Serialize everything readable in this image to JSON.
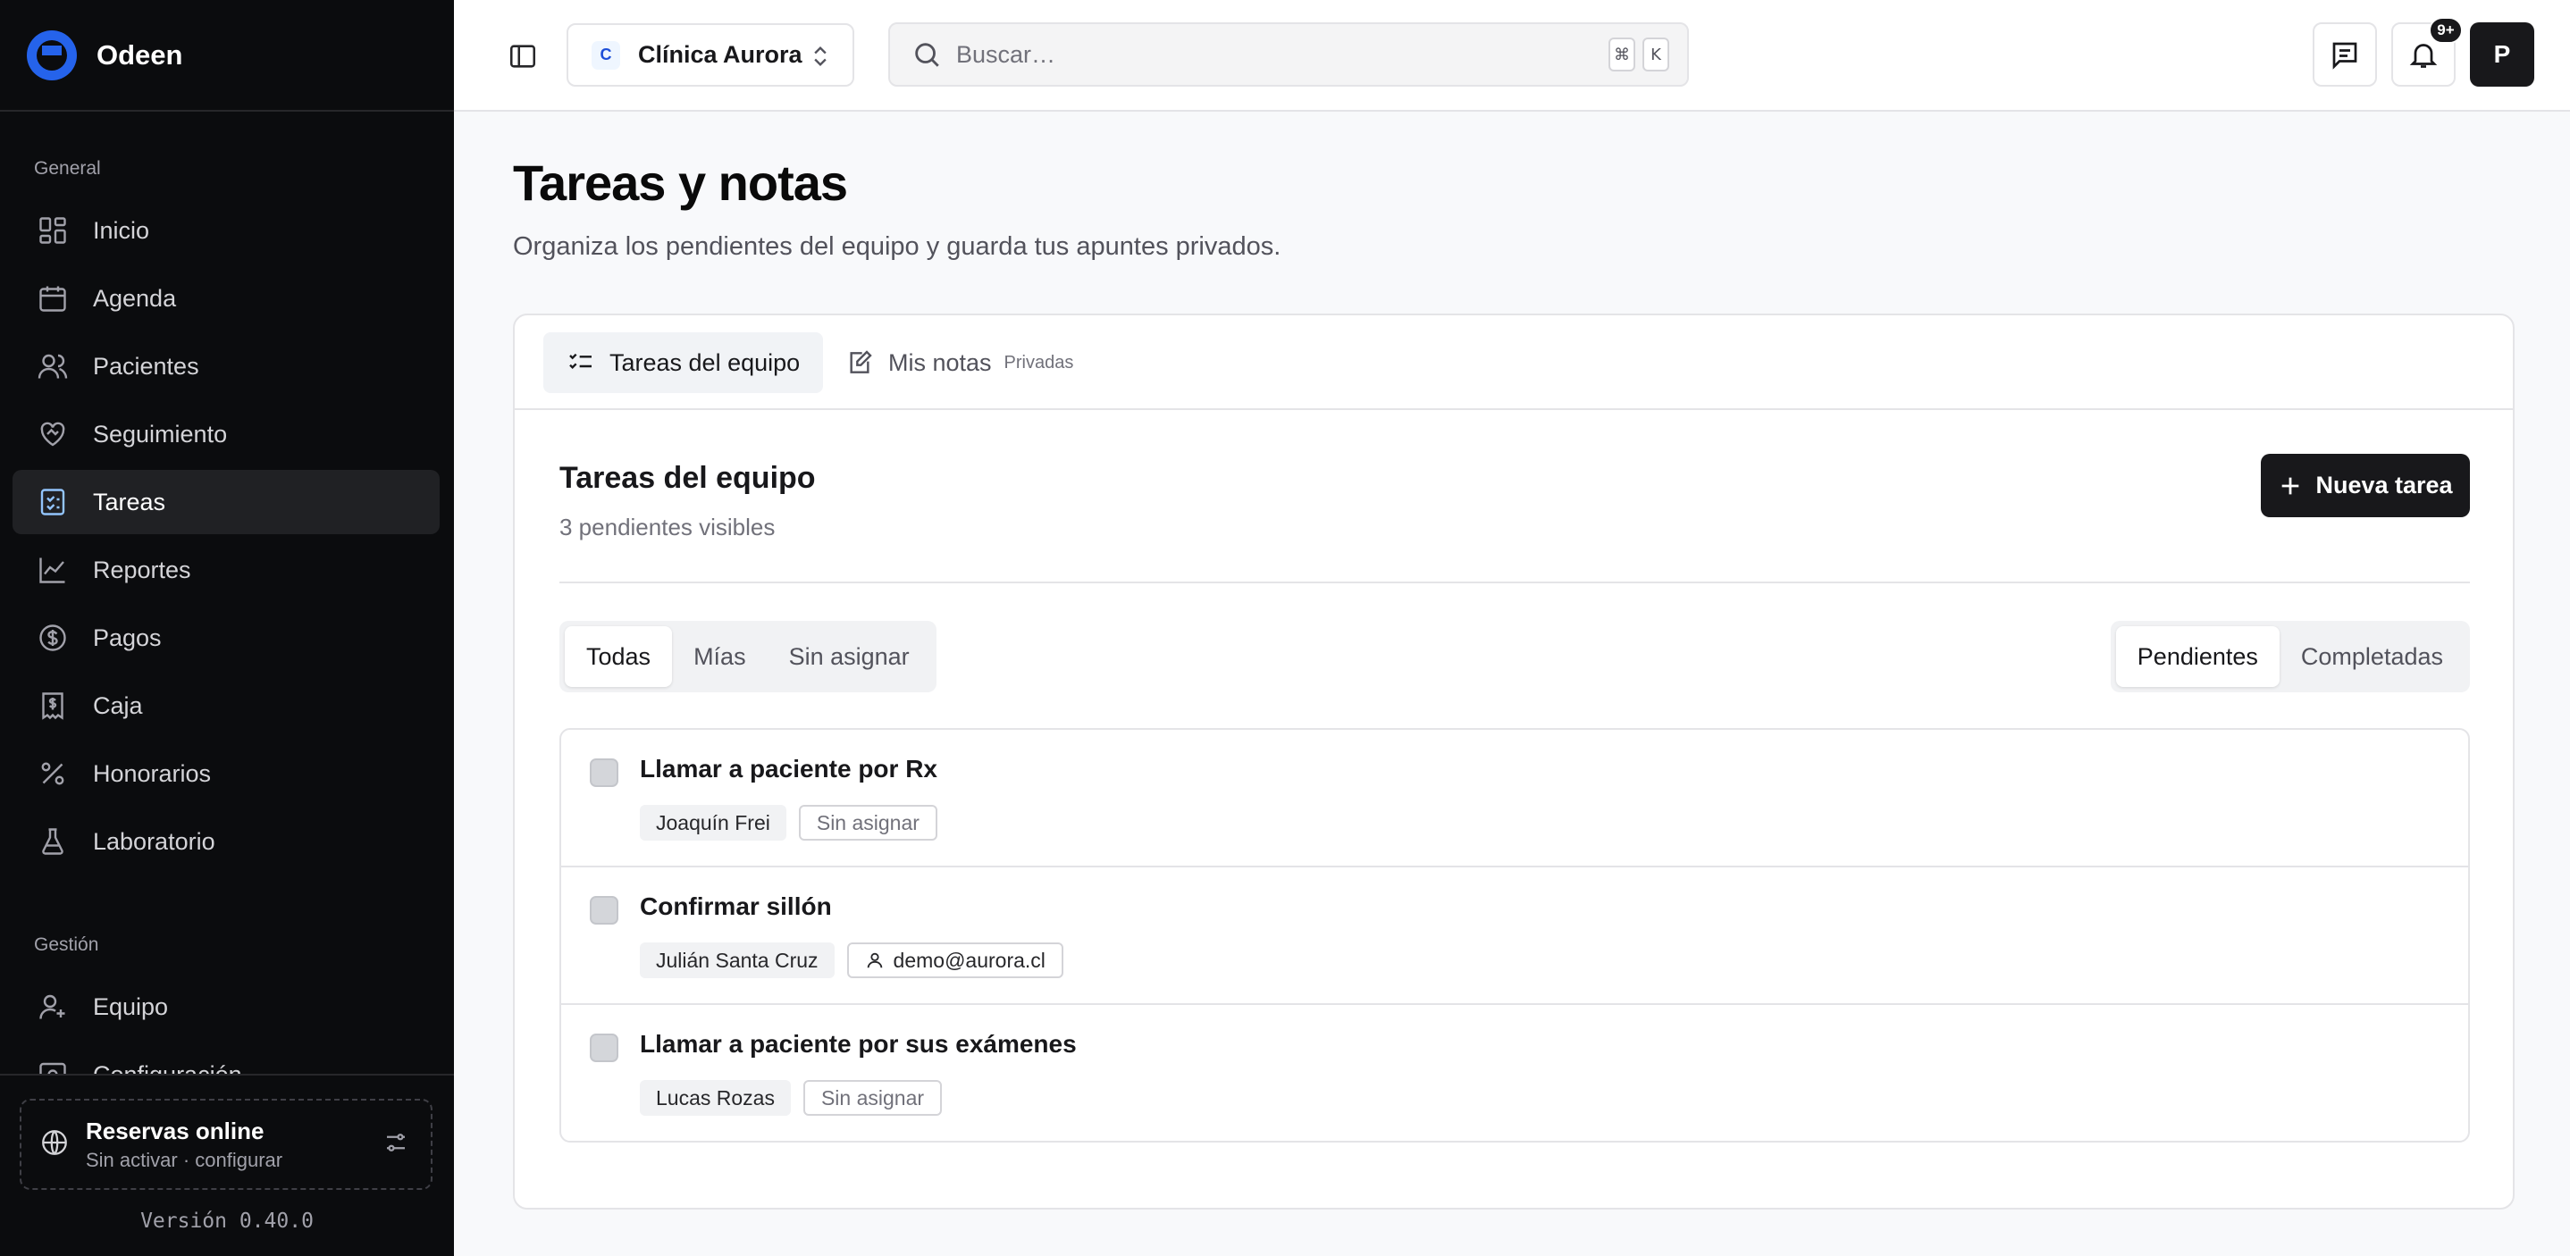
{
  "brand": {
    "name": "Odeen",
    "accent": "#2563eb"
  },
  "sidebar": {
    "general_heading": "General",
    "general_items": [
      {
        "label": "Inicio",
        "icon": "dashboard-icon"
      },
      {
        "label": "Agenda",
        "icon": "calendar-icon"
      },
      {
        "label": "Pacientes",
        "icon": "users-icon"
      },
      {
        "label": "Seguimiento",
        "icon": "heart-handshake-icon"
      },
      {
        "label": "Tareas",
        "icon": "clipboard-check-icon",
        "active": true
      },
      {
        "label": "Reportes",
        "icon": "line-chart-icon"
      },
      {
        "label": "Pagos",
        "icon": "dollar-circle-icon"
      },
      {
        "label": "Caja",
        "icon": "receipt-icon"
      },
      {
        "label": "Honorarios",
        "icon": "percent-icon"
      },
      {
        "label": "Laboratorio",
        "icon": "flask-icon"
      }
    ],
    "gestion_heading": "Gestión",
    "gestion_items": [
      {
        "label": "Equipo",
        "icon": "user-plus-icon"
      },
      {
        "label": "Configuración",
        "icon": "settings-icon"
      }
    ],
    "booking": {
      "title": "Reservas online",
      "subtitle": "Sin activar · configurar"
    },
    "version": "Versión 0.40.0"
  },
  "topbar": {
    "clinic_initial": "C",
    "clinic_name": "Clínica Aurora",
    "search_placeholder": "Buscar…",
    "search_shortcut": [
      "⌘",
      "K"
    ],
    "notifications_badge": "9+",
    "avatar_initial": "P"
  },
  "page": {
    "title": "Tareas y notas",
    "subtitle": "Organiza los pendientes del equipo y guarda tus apuntes privados."
  },
  "tabs": {
    "team": "Tareas del equipo",
    "notes": "Mis notas",
    "notes_tag": "Privadas"
  },
  "tasks_section": {
    "title": "Tareas del equipo",
    "count_text": "3 pendientes visibles",
    "new_button": "Nueva tarea",
    "filters": [
      "Todas",
      "Mías",
      "Sin asignar"
    ],
    "status": [
      "Pendientes",
      "Completadas"
    ],
    "items": [
      {
        "title": "Llamar a paciente por Rx",
        "patient": "Joaquín Frei",
        "assignee": "Sin asignar"
      },
      {
        "title": "Confirmar sillón",
        "patient": "Julián Santa Cruz",
        "assignee": "demo@aurora.cl"
      },
      {
        "title": "Llamar a paciente por sus exámenes",
        "patient": "Lucas Rozas",
        "assignee": "Sin asignar"
      }
    ]
  }
}
